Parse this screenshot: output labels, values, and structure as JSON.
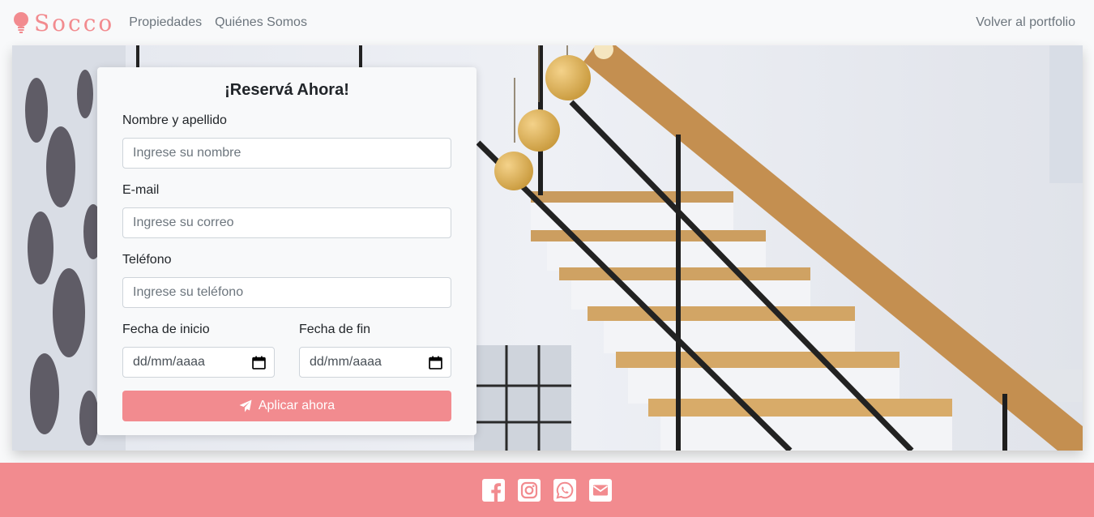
{
  "nav": {
    "brand": "Socco",
    "links": [
      "Propiedades",
      "Quiénes Somos"
    ],
    "right_link": "Volver al portfolio"
  },
  "form": {
    "title": "¡Reservá Ahora!",
    "name_label": "Nombre y apellido",
    "name_placeholder": "Ingrese su nombre",
    "email_label": "E-mail",
    "email_placeholder": "Ingrese su correo",
    "phone_label": "Teléfono",
    "phone_placeholder": "Ingrese su teléfono",
    "start_label": "Fecha de inicio",
    "start_value": "dd/mm/aaaa",
    "end_label": "Fecha de fin",
    "end_value": "dd/mm/aaaa",
    "submit_label": "Aplicar ahora"
  },
  "footer": {
    "icons": [
      "facebook-icon",
      "instagram-icon",
      "whatsapp-icon",
      "email-icon"
    ]
  },
  "colors": {
    "accent": "#f28b8f",
    "background": "#f8f9fa",
    "nav_text": "#6c757d"
  }
}
